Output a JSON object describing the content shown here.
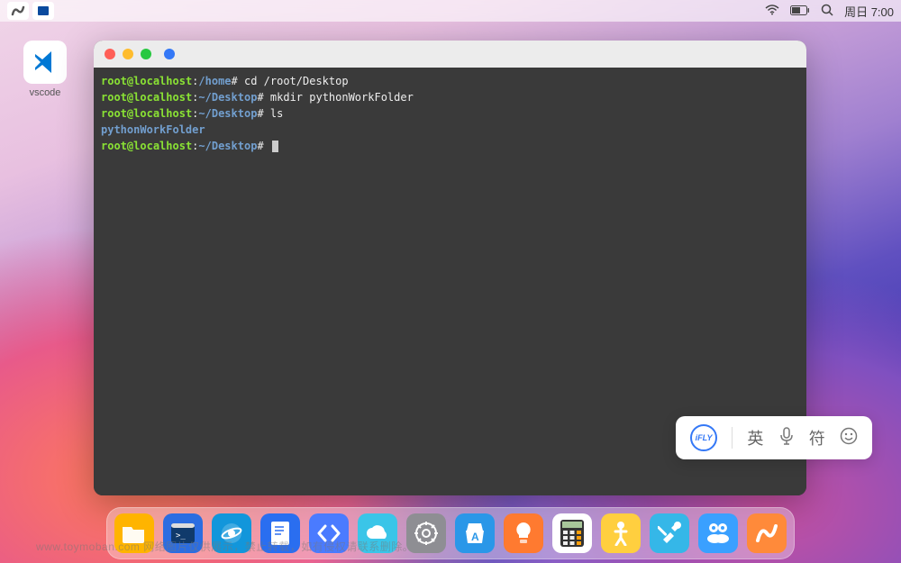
{
  "menubar": {
    "time": "周日 7:00"
  },
  "desktop": {
    "vscode_label": "vscode"
  },
  "terminal": {
    "lines": [
      {
        "user": "root",
        "host": "localhost",
        "sep1": "@",
        "sep2": ":",
        "path": "/home",
        "prompt": "#",
        "cmd": "cd /root/Desktop"
      },
      {
        "user": "root",
        "host": "localhost",
        "sep1": "@",
        "sep2": ":",
        "path": "~/Desktop",
        "prompt": "#",
        "cmd": "mkdir pythonWorkFolder"
      },
      {
        "user": "root",
        "host": "localhost",
        "sep1": "@",
        "sep2": ":",
        "path": "~/Desktop",
        "prompt": "#",
        "cmd": "ls"
      },
      {
        "output": "pythonWorkFolder"
      },
      {
        "user": "root",
        "host": "localhost",
        "sep1": "@",
        "sep2": ":",
        "path": "~/Desktop",
        "prompt": "#",
        "cmd": "",
        "cursor": true
      }
    ]
  },
  "ime": {
    "logo": "iFLY",
    "lang": "英",
    "sym": "符"
  },
  "dock": {
    "items": [
      {
        "name": "files",
        "bg": "#ffb400"
      },
      {
        "name": "terminal",
        "bg": "#2b6de1"
      },
      {
        "name": "browser",
        "bg": "#1296db"
      },
      {
        "name": "editor",
        "bg": "#2a6ef0"
      },
      {
        "name": "code",
        "bg": "#4a7bff"
      },
      {
        "name": "cloud",
        "bg": "#3ac5e8"
      },
      {
        "name": "settings",
        "bg": "#8e8e93"
      },
      {
        "name": "store",
        "bg": "#2a97e8"
      },
      {
        "name": "tips",
        "bg": "#ff7a30"
      },
      {
        "name": "calculator",
        "bg": "#ffffff"
      },
      {
        "name": "accessibility",
        "bg": "#ffcf3f"
      },
      {
        "name": "tools",
        "bg": "#35b7e8"
      },
      {
        "name": "game",
        "bg": "#3aa0ff"
      },
      {
        "name": "app",
        "bg": "#ff8a3a"
      }
    ]
  },
  "watermark": "www.toymoban.com    网络图片仅供展示，禁止转载，如有侵权请联系删除。"
}
